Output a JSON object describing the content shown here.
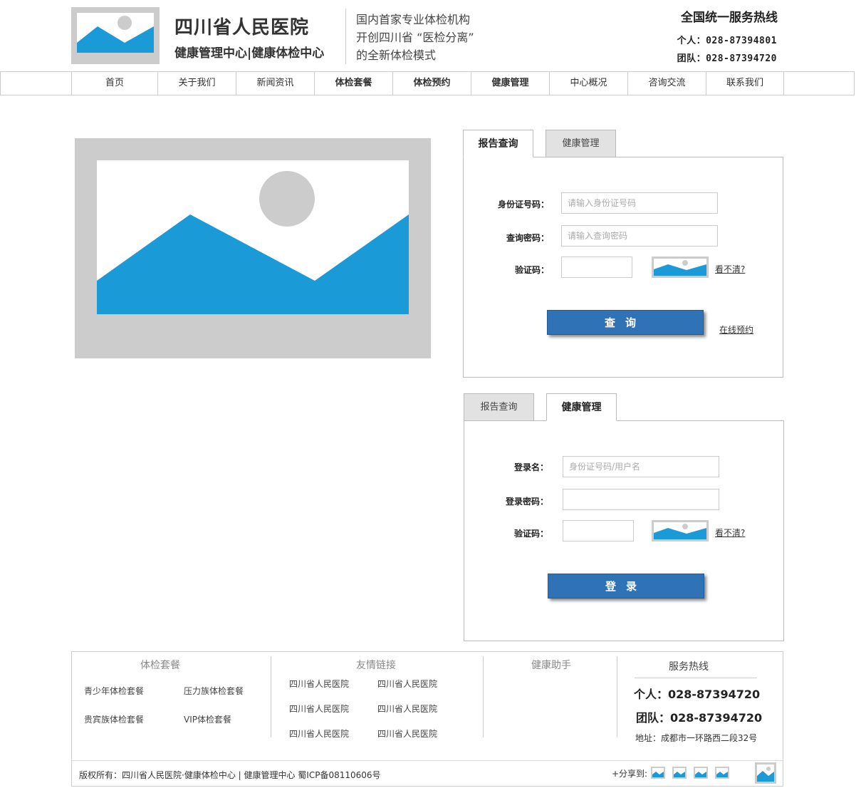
{
  "colors": {
    "accent_blue": "#1a9ad6",
    "button_blue": "#2f72b5",
    "placeholder_gray": "#cccccc",
    "sun_gray": "#cccccc"
  },
  "header": {
    "logo_icon": "image-placeholder-icon",
    "title": "四川省人民医院",
    "subtitle": "健康管理中心|健康体检中心",
    "slogan": [
      "国内首家专业体检机构",
      "开创四川省 “医检分离”",
      "的全新体检模式"
    ],
    "hotline_title": "全国统一服务热线",
    "hotline_personal": "个人：028-87394801",
    "hotline_team": "团队：028-87394720"
  },
  "nav": [
    "首页",
    "关于我们",
    "新闻资讯",
    "体检套餐",
    "体检预约",
    "健康管理",
    "中心概况",
    "咨询交流",
    "联系我们"
  ],
  "banner": {
    "icon": "image-placeholder-icon"
  },
  "report_panel": {
    "tabs": [
      "报告查询",
      "健康管理"
    ],
    "id_label": "身份证号码：",
    "id_placeholder": "请输入身份证号码",
    "pwd_label": "查询密码：",
    "pwd_placeholder": "请输入查询密码",
    "captcha_label": "验证码：",
    "captcha_refresh": "看不清?",
    "submit": "查询",
    "online_booking": "在线预约"
  },
  "health_panel": {
    "tabs": [
      "报告查询",
      "健康管理"
    ],
    "user_label": "登录名：",
    "user_placeholder": "身份证号码/用户名",
    "pwd_label": "登录密码：",
    "captcha_label": "验证码：",
    "captcha_refresh": "看不清?",
    "submit": "登录"
  },
  "footer": {
    "packages_title": "体检套餐",
    "packages": [
      "青少年体检套餐",
      "压力族体检套餐",
      "贵宾族体检套餐",
      "VIP体检套餐"
    ],
    "links_title": "友情链接",
    "links": [
      "四川省人民医院",
      "四川省人民医院",
      "四川省人民医院",
      "四川省人民医院",
      "四川省人民医院",
      "四川省人民医院"
    ],
    "assistant_title": "健康助手",
    "service_title": "服务热线",
    "service_personal": "个人：028-87394720",
    "service_team": "团队：028-87394720",
    "address": "地址：成都市一环路西二段32号",
    "copyright": "版权所有：四川省人民医院·健康体检中心 | 健康管理中心  蜀ICP备08110606号",
    "share_label": "+分享到:"
  }
}
